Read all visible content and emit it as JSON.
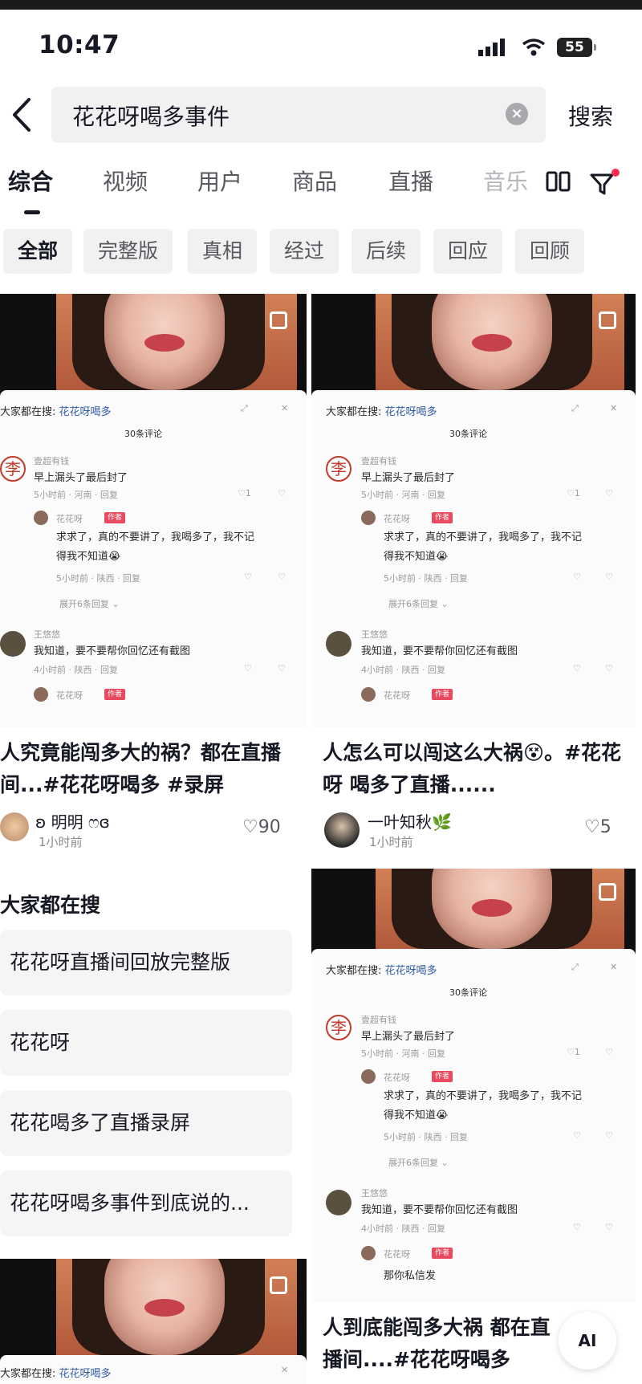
{
  "status_bar": {
    "time": "10:47",
    "battery": "55"
  },
  "search": {
    "query": "花花呀喝多事件",
    "search_button": "搜索"
  },
  "tabs": [
    "综合",
    "视频",
    "用户",
    "商品",
    "直播",
    "音乐"
  ],
  "chips": [
    "全部",
    "完整版",
    "真相",
    "经过",
    "后续",
    "回应",
    "回顾"
  ],
  "shot": {
    "header": "大家都在搜:",
    "search_term": "花花呀喝多",
    "comment_count": "30条评论",
    "c1_user": "壹超有钱",
    "c1_text": "早上漏头了最后封了",
    "c1_meta": "5小时前 · 河南 · 回复",
    "c1_likes": "1",
    "c2_user": "花花呀",
    "c2_tag": "作者",
    "c2_text_line1": "求求了，真的不要讲了，我喝多了，我不记",
    "c2_text_line2": "得我不知道😭",
    "c2_meta": "5小时前 · 陕西 · 回复",
    "expand": "展开6条回复 ⌄",
    "c3_user": "王悠悠",
    "c3_text": "我知道，要不要帮你回忆还有截图",
    "c3_meta": "4小时前 · 陕西 · 回复",
    "c4_user": "花花呀",
    "c4_text": "那你私信发"
  },
  "cards": [
    {
      "caption": "人究竟能闯多大的祸？都在直播间...#花花呀喝多 #录屏",
      "author": "ʚ 明明 ෆɞ",
      "time": "1小时前",
      "likes": "90"
    },
    {
      "caption": "人怎么可以闯这么大祸😵。#花花呀 喝多了直播......",
      "author": "一叶知秋🌿",
      "time": "1小时前",
      "likes": "5"
    },
    {
      "caption": "人到底能闯多大祸 都在直播间....#花花呀喝多"
    }
  ],
  "suggestions": {
    "title": "大家都在搜",
    "items": [
      "花花呀直播间回放完整版",
      "花花呀",
      "花花喝多了直播录屏",
      "花花呀喝多事件到底说的..."
    ]
  },
  "ai_button": "AI",
  "colors": {
    "accent_red": "#fe2c55",
    "text": "#161823",
    "chip_bg": "#f1f1f2",
    "link_blue": "#2f5aa8"
  }
}
